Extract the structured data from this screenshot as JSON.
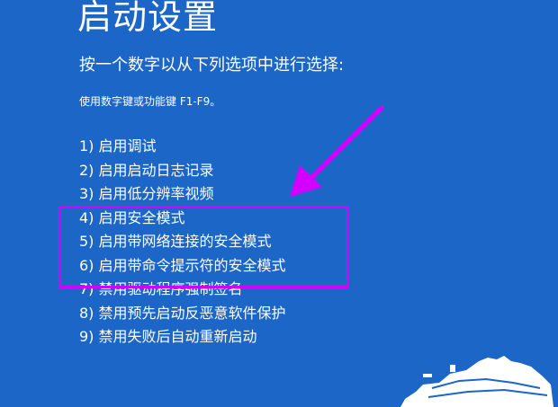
{
  "screen": {
    "title": "启动设置",
    "prompt": "按一个数字以从下列选项中进行选择:",
    "hint": "使用数字键或功能键 F1-F9。"
  },
  "options": [
    "1) 启用调试",
    "2) 启用启动日志记录",
    "3) 启用低分辨率视频",
    "4) 启用安全模式",
    "5) 启用带网络连接的安全模式",
    "6) 启用带命令提示符的安全模式",
    "7) 禁用驱动程序强制签名",
    "8) 禁用预先启动反恶意软件保护",
    "9) 禁用失败后自动重新启动"
  ],
  "colors": {
    "background": "#1b66c6",
    "text": "#ffffff",
    "annotation": "#d400ff"
  },
  "annotation": {
    "highlighted_options": [
      4,
      5,
      6
    ],
    "arrow_icon": "arrow-down-left-icon"
  }
}
